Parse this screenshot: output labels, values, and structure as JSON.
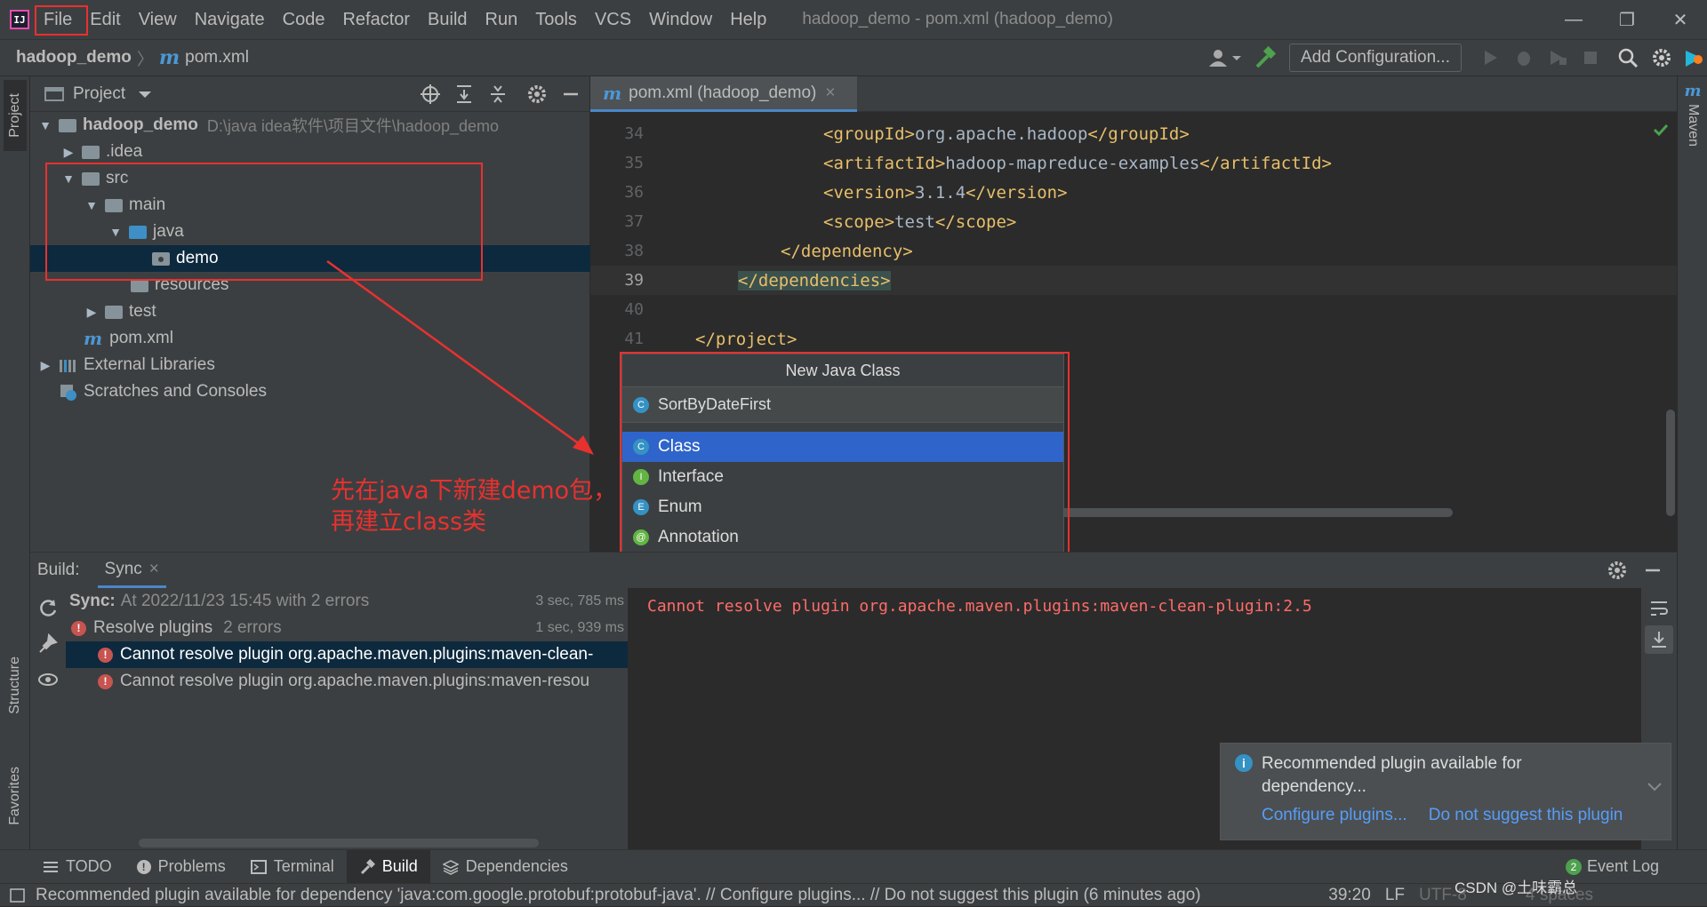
{
  "menubar": {
    "logo_text": "IJ",
    "items": [
      "File",
      "Edit",
      "View",
      "Navigate",
      "Code",
      "Refactor",
      "Build",
      "Run",
      "Tools",
      "VCS",
      "Window",
      "Help"
    ],
    "window_title": "hadoop_demo - pom.xml (hadoop_demo)",
    "minimize": "—",
    "restore": "❐",
    "close": "✕"
  },
  "navbar": {
    "project": "hadoop_demo",
    "separator": "〉",
    "file_logo": "m",
    "file": "pom.xml",
    "add_config": "Add Configuration..."
  },
  "left_strip": {
    "project": "Project",
    "structure": "Structure",
    "favorites": "Favorites"
  },
  "right_strip": {
    "maven_logo": "m",
    "maven": "Maven"
  },
  "project_panel": {
    "title": "Project",
    "root_name": "hadoop_demo",
    "root_path": "D:\\java idea软件\\项目文件\\hadoop_demo",
    "items": [
      ".idea",
      "src",
      "main",
      "java",
      "demo",
      "resources",
      "test",
      "pom.xml",
      "External Libraries",
      "Scratches and Consoles"
    ]
  },
  "editor": {
    "tab_label": "pom.xml (hadoop_demo)",
    "tab_logo": "m",
    "tab_close": "×",
    "lines": [
      {
        "num": "34",
        "code": "<groupId>org.apache.hadoop</groupId>"
      },
      {
        "num": "35",
        "code": "<artifactId>hadoop-mapreduce-examples</artifactId>"
      },
      {
        "num": "36",
        "code": "<version>3.1.4</version>"
      },
      {
        "num": "37",
        "code": "<scope>test</scope>"
      },
      {
        "num": "38",
        "code": "</dependency>"
      },
      {
        "num": "39",
        "code": "</dependencies>"
      },
      {
        "num": "40",
        "code": ""
      },
      {
        "num": "41",
        "code": "</project>"
      }
    ]
  },
  "popup": {
    "title": "New Java Class",
    "input_value": "SortByDateFirst",
    "options": [
      {
        "label": "Class",
        "letter": "C",
        "color": "#3592c4"
      },
      {
        "label": "Interface",
        "letter": "I",
        "color": "#62b543"
      },
      {
        "label": "Enum",
        "letter": "E",
        "color": "#3592c4"
      },
      {
        "label": "Annotation",
        "letter": "@",
        "color": "#62b543"
      }
    ]
  },
  "annotation": {
    "line1": "先在java下新建demo包，",
    "line2": "再建立class类"
  },
  "build": {
    "label": "Build:",
    "tab": "Sync",
    "tab_close": "×",
    "rows": [
      {
        "title": "Sync:",
        "text": "At 2022/11/23 15:45 with 2 errors",
        "time": "3 sec, 785 ms"
      },
      {
        "title": "Resolve plugins",
        "text": "2 errors",
        "time": "1 sec, 939 ms"
      },
      {
        "text": "Cannot resolve plugin org.apache.maven.plugins:maven-clean-"
      },
      {
        "text": "Cannot resolve plugin org.apache.maven.plugins:maven-resou"
      }
    ],
    "console_text": "Cannot resolve plugin org.apache.maven.plugins:maven-clean-plugin:2.5"
  },
  "notification": {
    "message": "Recommended plugin available for dependency...",
    "action1": "Configure plugins...",
    "action2": "Do not suggest this plugin"
  },
  "bottom_tabs": [
    "TODO",
    "Problems",
    "Terminal",
    "Build",
    "Dependencies"
  ],
  "event_log": {
    "badge": "2",
    "label": "Event Log"
  },
  "statusbar": {
    "message": "Recommended plugin available for dependency 'java:com.google.protobuf:protobuf-java'. // Configure plugins... // Do not suggest this plugin (6 minutes ago)",
    "position": "39:20",
    "line_sep": "LF",
    "encoding": "UTF-8",
    "indent": "4 spaces",
    "watermark": "CSDN @土味霸总"
  },
  "colors": {
    "accent_red": "#e8312f",
    "selection": "#0d293e",
    "popup_selected": "#2f65ca"
  }
}
